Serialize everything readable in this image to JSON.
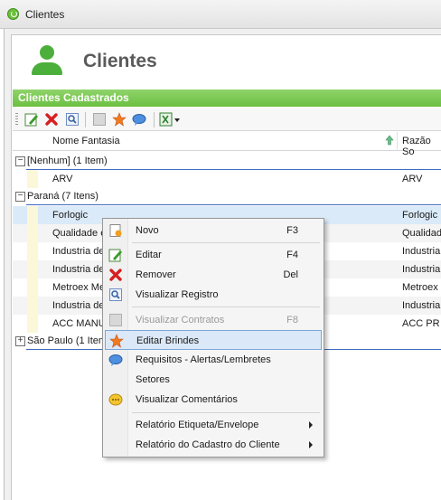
{
  "window": {
    "title": "Clientes"
  },
  "header": {
    "title": "Clientes"
  },
  "section": {
    "title": "Clientes Cadastrados"
  },
  "columns": {
    "fantasia": "Nome Fantasia",
    "razao": "Razão So"
  },
  "groups": [
    {
      "label": "[Nenhum] (1 Item)",
      "toggle": "−"
    },
    {
      "label": "Paraná (7 Itens)",
      "toggle": "−"
    },
    {
      "label": "São Paulo (1 Item",
      "toggle": "+"
    }
  ],
  "rows": [
    {
      "fantasia": "ARV",
      "razao": "ARV"
    },
    {
      "fantasia": "Forlogic",
      "razao": "Forlogic"
    },
    {
      "fantasia": "Qualidade e",
      "razao": "Qualidad"
    },
    {
      "fantasia": "Industria de",
      "razao": "Industria"
    },
    {
      "fantasia": "Industria de",
      "razao": "Industria"
    },
    {
      "fantasia": "Metroex Me",
      "razao": "Metroex I"
    },
    {
      "fantasia": "Industria de",
      "razao": "Industria"
    },
    {
      "fantasia": "ACC MANUT",
      "razao": "ACC PR I"
    }
  ],
  "menu": {
    "novo": {
      "label": "Novo",
      "key": "F3"
    },
    "editar": {
      "label": "Editar",
      "key": "F4"
    },
    "remover": {
      "label": "Remover",
      "key": "Del"
    },
    "visualizar": {
      "label": "Visualizar Registro"
    },
    "contratos": {
      "label": "Visualizar Contratos",
      "key": "F8"
    },
    "brindes": {
      "label": "Editar Brindes"
    },
    "requisitos": {
      "label": "Requisitos - Alertas/Lembretes"
    },
    "setores": {
      "label": "Setores"
    },
    "comentarios": {
      "label": "Visualizar Comentários"
    },
    "etiqueta": {
      "label": "Relatório Etiqueta/Envelope"
    },
    "cadastro": {
      "label": "Relatório do Cadastro do Cliente"
    }
  },
  "colors": {
    "accent_green": "#6cbf42",
    "highlight": "#dbe8f7"
  }
}
